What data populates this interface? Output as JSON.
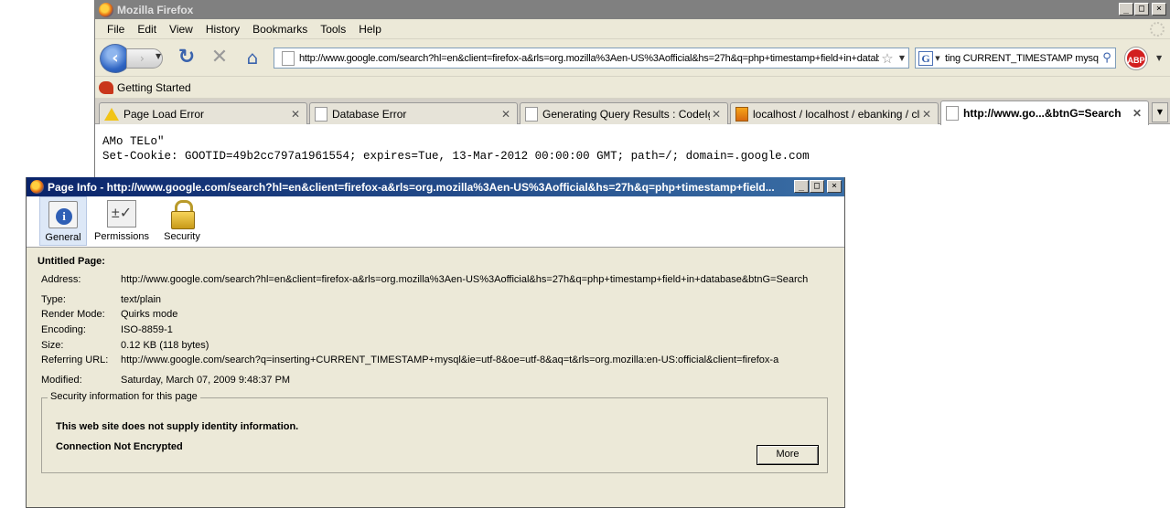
{
  "browser": {
    "title": "Mozilla Firefox",
    "menu": [
      "File",
      "Edit",
      "View",
      "History",
      "Bookmarks",
      "Tools",
      "Help"
    ],
    "url": "http://www.google.com/search?hl=en&client=firefox-a&rls=org.mozilla%3Aen-US%3Aofficial&hs=27h&q=php+timestamp+field+in+database&btnG=Search",
    "search_text": "ting CURRENT_TIMESTAMP mysql",
    "abp_label": "ABP",
    "bookmarks": [
      {
        "label": "Getting Started"
      }
    ],
    "tabs": [
      {
        "label": "Page Load Error",
        "icon": "warning-icon"
      },
      {
        "label": "Database Error",
        "icon": "page-icon"
      },
      {
        "label": "Generating Query Results : CodeIg...",
        "icon": "page-icon"
      },
      {
        "label": "localhost / localhost / ebanking / cli...",
        "icon": "phpmyadmin-icon"
      },
      {
        "label": "http://www.go...&btnG=Search",
        "icon": "page-icon",
        "active": true
      }
    ],
    "content_lines": [
      "AMo TELo\"",
      "Set-Cookie: GOOTID=49b2cc797a1961554; expires=Tue, 13-Mar-2012 00:00:00 GMT; path=/; domain=.google.com"
    ]
  },
  "page_info": {
    "title": "Page Info - http://www.google.com/search?hl=en&client=firefox-a&rls=org.mozilla%3Aen-US%3Aofficial&hs=27h&q=php+timestamp+field...",
    "tabs": [
      {
        "label": "General",
        "icon": "page-info-icon",
        "selected": true
      },
      {
        "label": "Permissions",
        "icon": "permissions-icon"
      },
      {
        "label": "Security",
        "icon": "lock-icon"
      }
    ],
    "heading": "Untitled Page:",
    "fields": {
      "address": {
        "label": "Address:",
        "value": "http://www.google.com/search?hl=en&client=firefox-a&rls=org.mozilla%3Aen-US%3Aofficial&hs=27h&q=php+timestamp+field+in+database&btnG=Search"
      },
      "type": {
        "label": "Type:",
        "value": "text/plain"
      },
      "render_mode": {
        "label": "Render Mode:",
        "value": "Quirks mode"
      },
      "encoding": {
        "label": "Encoding:",
        "value": "ISO-8859-1"
      },
      "size": {
        "label": "Size:",
        "value": "0.12 KB (118 bytes)"
      },
      "referring_url": {
        "label": "Referring URL:",
        "value": "http://www.google.com/search?q=inserting+CURRENT_TIMESTAMP+mysql&ie=utf-8&oe=utf-8&aq=t&rls=org.mozilla:en-US:official&client=firefox-a"
      },
      "modified": {
        "label": "Modified:",
        "value": "Saturday, March 07, 2009 9:48:37 PM"
      }
    },
    "security": {
      "legend": "Security information for this page",
      "identity": "This web site does not supply identity information.",
      "connection": "Connection Not Encrypted",
      "more_label": "More"
    }
  }
}
